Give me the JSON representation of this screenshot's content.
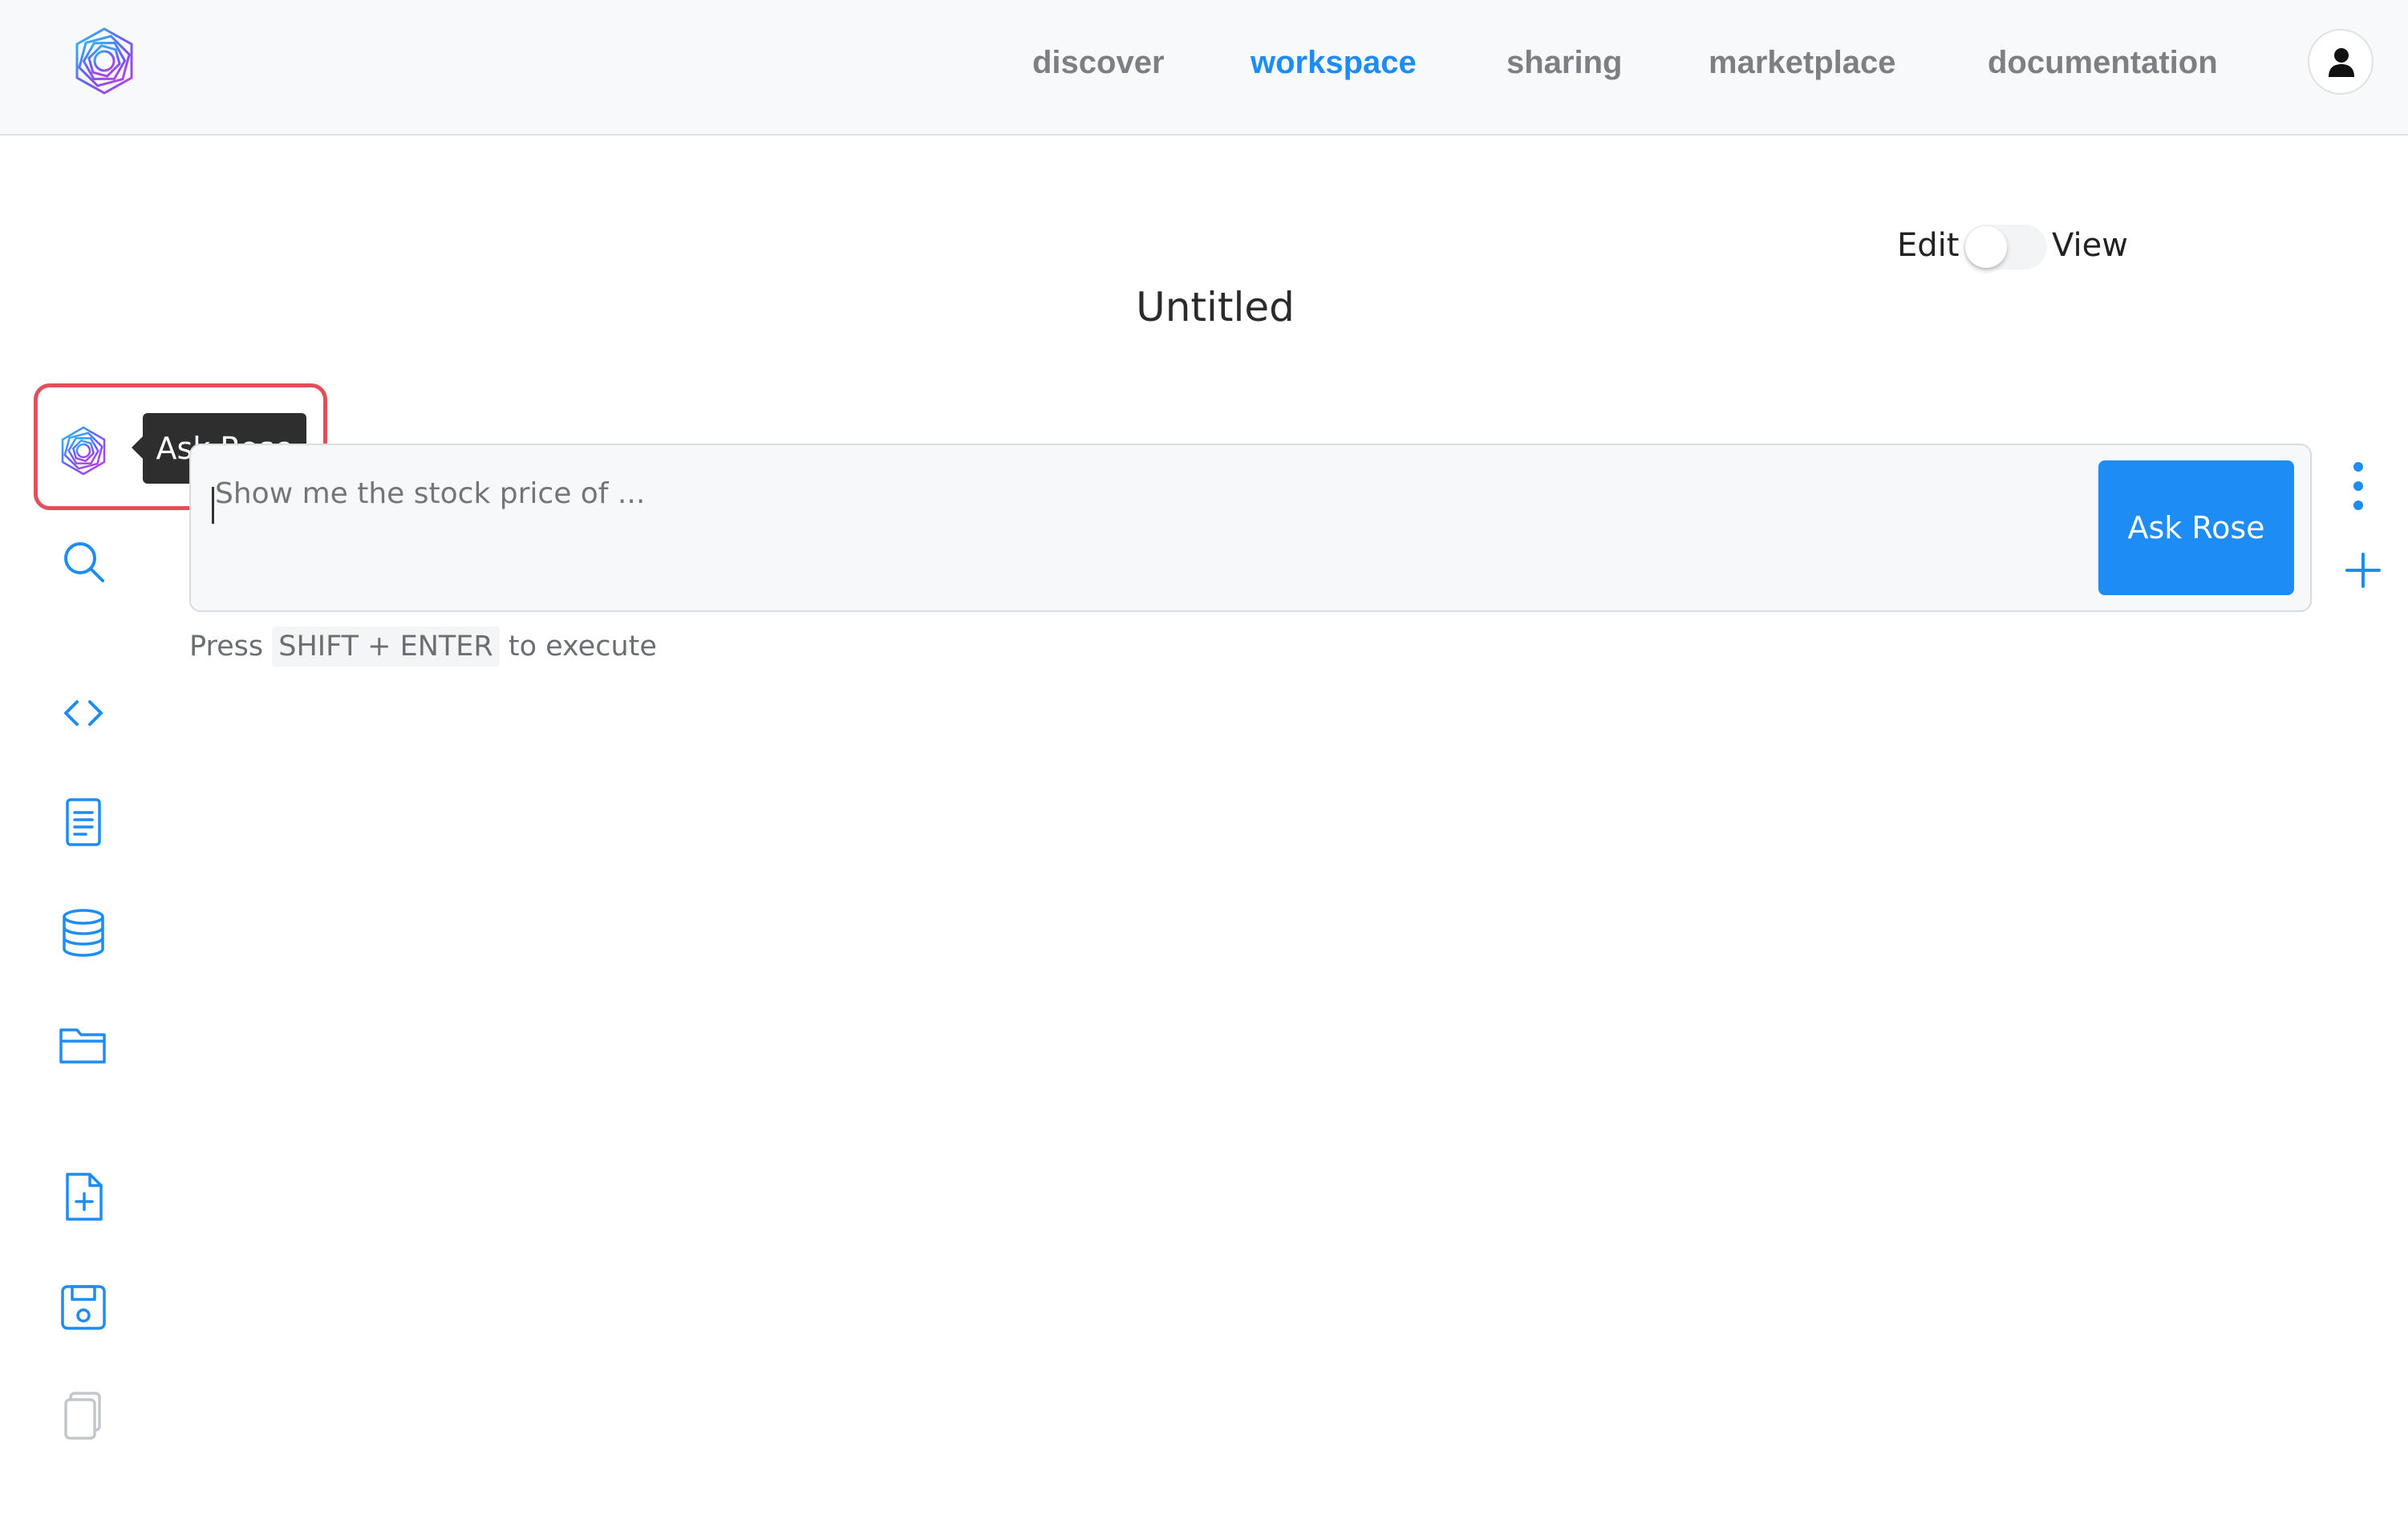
{
  "nav": {
    "items": [
      {
        "label": "discover",
        "active": false
      },
      {
        "label": "workspace",
        "active": true
      },
      {
        "label": "sharing",
        "active": false
      },
      {
        "label": "marketplace",
        "active": false
      },
      {
        "label": "documentation",
        "active": false
      }
    ],
    "profile_icon": "user-icon",
    "logo_icon": "rose-logo-icon"
  },
  "mode_toggle": {
    "edit_label": "Edit",
    "view_label": "View",
    "state": "edit"
  },
  "notebook": {
    "title": "Untitled"
  },
  "sidebar": {
    "items": [
      {
        "icon": "ask-rose-icon",
        "tooltip": "Ask Rose",
        "highlighted": true
      },
      {
        "icon": "search-icon"
      },
      {
        "icon": "code-icon"
      },
      {
        "icon": "document-icon"
      },
      {
        "icon": "database-icon"
      },
      {
        "icon": "folder-icon"
      },
      {
        "icon": "new-file-icon"
      },
      {
        "icon": "save-icon"
      },
      {
        "icon": "copy-icon",
        "disabled": true
      }
    ]
  },
  "cell": {
    "placeholder": "Show me the stock price of ...",
    "value": "",
    "submit_label": "Ask Rose",
    "menu_icon": "kebab-menu-icon",
    "add_icon": "plus-icon"
  },
  "hint": {
    "prefix": "Press",
    "keys": "SHIFT + ENTER",
    "suffix": "to execute"
  },
  "colors": {
    "accent": "#1d8cf5",
    "highlight": "#e14f5a",
    "tooltip_bg": "#2e2e2e"
  }
}
